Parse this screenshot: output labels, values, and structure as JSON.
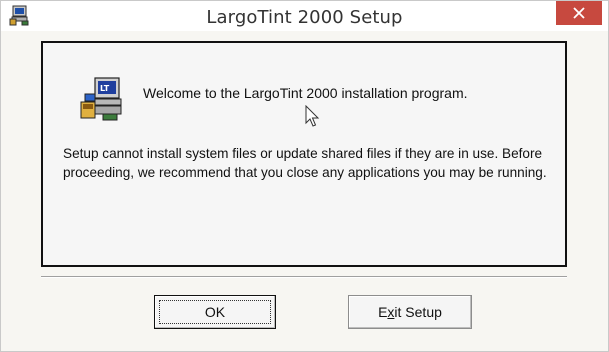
{
  "window": {
    "title": "LargoTint 2000 Setup"
  },
  "content": {
    "welcome": "Welcome to the LargoTint 2000 installation program.",
    "message": "Setup cannot install system files or update shared files if they are in use. Before proceeding, we recommend that you close any applications you may be running."
  },
  "buttons": {
    "ok_label": "OK",
    "exit_pre": "E",
    "exit_accel": "x",
    "exit_post": "it Setup"
  },
  "icons": {
    "app": "setup-computer-icon",
    "close": "close-icon",
    "cursor": "mouse-cursor-icon"
  },
  "colors": {
    "close_button": "#c7493f",
    "window_bg": "#f7f6f2"
  }
}
